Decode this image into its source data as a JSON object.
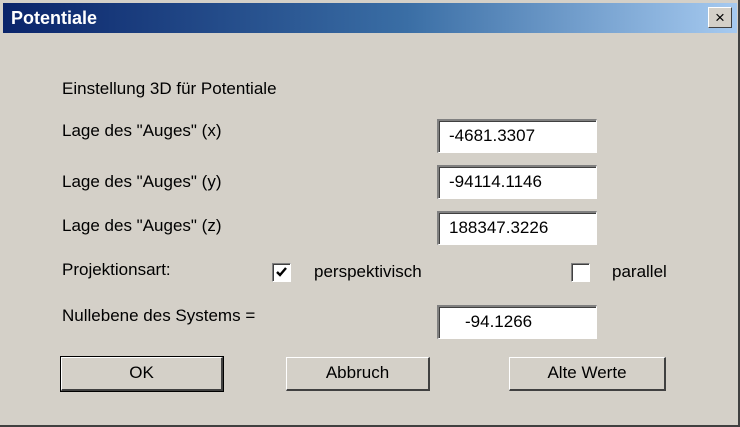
{
  "window": {
    "title": "Potentiale",
    "close_glyph": "×"
  },
  "form": {
    "heading": "Einstellung 3D für Potentiale",
    "eye_x_label": "Lage des \"Auges\" (x)",
    "eye_x_value": "-4681.3307",
    "eye_y_label": "Lage des \"Auges\" (y)",
    "eye_y_value": "-94114.1146",
    "eye_z_label": "Lage des \"Auges\" (z)",
    "eye_z_value": "188347.3226",
    "projection_label": "Projektionsart:",
    "perspective_label": "perspektivisch",
    "perspective_checked": true,
    "parallel_label": "parallel",
    "parallel_checked": false,
    "zero_plane_label": "Nullebene des Systems =",
    "zero_plane_value": "-94.1266"
  },
  "buttons": {
    "ok": "OK",
    "cancel": "Abbruch",
    "old_values": "Alte Werte"
  }
}
